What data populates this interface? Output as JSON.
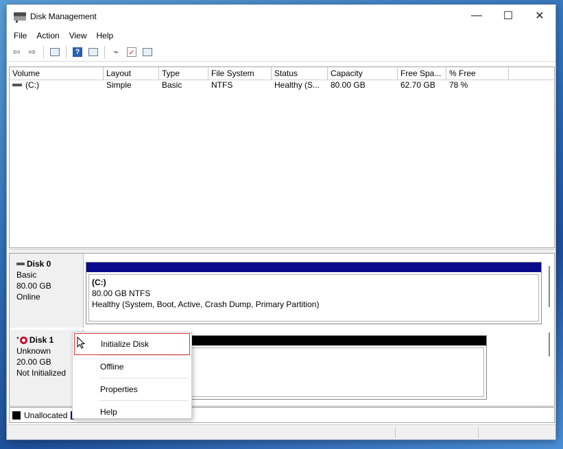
{
  "window": {
    "title": "Disk Management",
    "minimize": "—",
    "maximize": "☐",
    "close": "✕"
  },
  "menu": [
    "File",
    "Action",
    "View",
    "Help"
  ],
  "toolbar": {
    "back_icon": "back-arrow-icon",
    "forward_icon": "forward-arrow-icon"
  },
  "volumes": {
    "columns": [
      "Volume",
      "Layout",
      "Type",
      "File System",
      "Status",
      "Capacity",
      "Free Spa...",
      "% Free"
    ],
    "rows": [
      [
        "(C:)",
        "Simple",
        "Basic",
        "NTFS",
        "Healthy (S...",
        "80.00 GB",
        "62.70 GB",
        "78 %"
      ]
    ]
  },
  "disks": [
    {
      "name": "Disk 0",
      "type": "Basic",
      "size": "80.00 GB",
      "state": "Online",
      "partition": {
        "label": "(C:)",
        "size_fs": "80.00 GB NTFS",
        "status": "Healthy (System, Boot, Active, Crash Dump, Primary Partition)"
      }
    },
    {
      "name": "Disk 1",
      "prefix": "*",
      "type": "Unknown",
      "size": "20.00 GB",
      "state": "Not Initialized"
    }
  ],
  "legend": {
    "unallocated": "Unallocated",
    "unallocated_color": "#000000",
    "primary_color": "#00008b"
  },
  "context_menu": [
    "Initialize Disk",
    "Offline",
    "Properties",
    "Help"
  ],
  "colors": {
    "primary_partition_bar": "#0a0a8c",
    "unallocated_bar": "#000000",
    "highlight_border": "#d9343b"
  }
}
